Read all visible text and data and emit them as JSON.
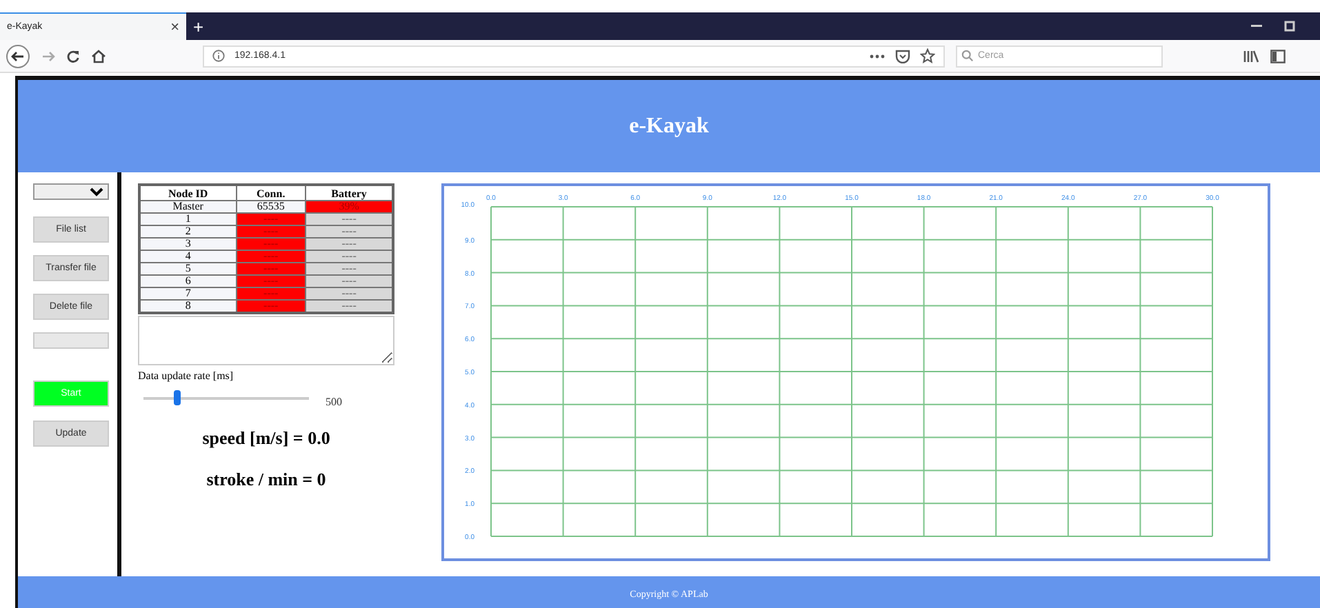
{
  "browser": {
    "tab_title": "e-Kayak",
    "tab_close": "×",
    "new_tab": "+",
    "address": "192.168.4.1",
    "search": {
      "placeholder": "Cerca"
    }
  },
  "header": {
    "title": "e-Kayak"
  },
  "sidebar": {
    "items": [
      {
        "kind": "select"
      },
      {
        "kind": "button",
        "label": "File list"
      },
      {
        "kind": "button",
        "label": "Transfer file"
      },
      {
        "kind": "button",
        "label": "Delete file"
      },
      {
        "kind": "field"
      },
      {
        "kind": "go",
        "label": "Start"
      },
      {
        "kind": "button",
        "label": "Update"
      }
    ]
  },
  "table": {
    "columns": [
      "Node ID",
      "Conn.",
      "Battery"
    ],
    "rows": [
      {
        "cells": [
          {
            "text": "Master",
            "alert": false
          },
          {
            "text": "65535",
            "alert": false
          },
          {
            "text": "39%",
            "alert": true
          }
        ]
      },
      {
        "cells": [
          {
            "text": "1",
            "alert": false
          },
          {
            "text": "----",
            "alert": true
          },
          {
            "text": "----",
            "alert": false
          }
        ]
      },
      {
        "cells": [
          {
            "text": "2",
            "alert": false
          },
          {
            "text": "----",
            "alert": true
          },
          {
            "text": "----",
            "alert": false
          }
        ]
      },
      {
        "cells": [
          {
            "text": "3",
            "alert": false
          },
          {
            "text": "----",
            "alert": true
          },
          {
            "text": "----",
            "alert": false
          }
        ]
      },
      {
        "cells": [
          {
            "text": "4",
            "alert": false
          },
          {
            "text": "----",
            "alert": true
          },
          {
            "text": "----",
            "alert": false
          }
        ]
      },
      {
        "cells": [
          {
            "text": "5",
            "alert": false
          },
          {
            "text": "----",
            "alert": true
          },
          {
            "text": "----",
            "alert": false
          }
        ]
      },
      {
        "cells": [
          {
            "text": "6",
            "alert": false
          },
          {
            "text": "----",
            "alert": true
          },
          {
            "text": "----",
            "alert": false
          }
        ]
      },
      {
        "cells": [
          {
            "text": "7",
            "alert": false
          },
          {
            "text": "----",
            "alert": true
          },
          {
            "text": "----",
            "alert": false
          }
        ]
      },
      {
        "cells": [
          {
            "text": "8",
            "alert": false
          },
          {
            "text": "----",
            "alert": true
          },
          {
            "text": "----",
            "alert": false
          }
        ]
      }
    ]
  },
  "rate": {
    "label": "Data update rate [ms]",
    "level": 0.2,
    "reading": "500"
  },
  "speed": "speed [m/s] = 0.0",
  "stroke": "stroke / min = 0",
  "chart": {
    "chart_data": {
      "type": "line",
      "grid": true,
      "xlim": [
        0,
        30
      ],
      "ylim": [
        0,
        10
      ],
      "xticks": [
        {
          "value": 0,
          "label": "0.0"
        },
        {
          "value": 3,
          "label": "3.0"
        },
        {
          "value": 6,
          "label": "6.0"
        },
        {
          "value": 9,
          "label": "9.0"
        },
        {
          "value": 12,
          "label": "12.0"
        },
        {
          "value": 15,
          "label": "15.0"
        },
        {
          "value": 18,
          "label": "18.0"
        },
        {
          "value": 21,
          "label": "21.0"
        },
        {
          "value": 24,
          "label": "24.0"
        },
        {
          "value": 27,
          "label": "27.0"
        },
        {
          "value": 30,
          "label": "30.0"
        }
      ],
      "yticks": [
        {
          "value": 0,
          "label": "0.0"
        },
        {
          "value": 1,
          "label": "1.0"
        },
        {
          "value": 2,
          "label": "2.0"
        },
        {
          "value": 3,
          "label": "3.0"
        },
        {
          "value": 4,
          "label": "4.0"
        },
        {
          "value": 5,
          "label": "5.0"
        },
        {
          "value": 6,
          "label": "6.0"
        },
        {
          "value": 7,
          "label": "7.0"
        },
        {
          "value": 8,
          "label": "8.0"
        },
        {
          "value": 9,
          "label": "9.0"
        },
        {
          "value": 10,
          "label": "10.0"
        }
      ]
    }
  },
  "footer": "Copyright © APLab"
}
